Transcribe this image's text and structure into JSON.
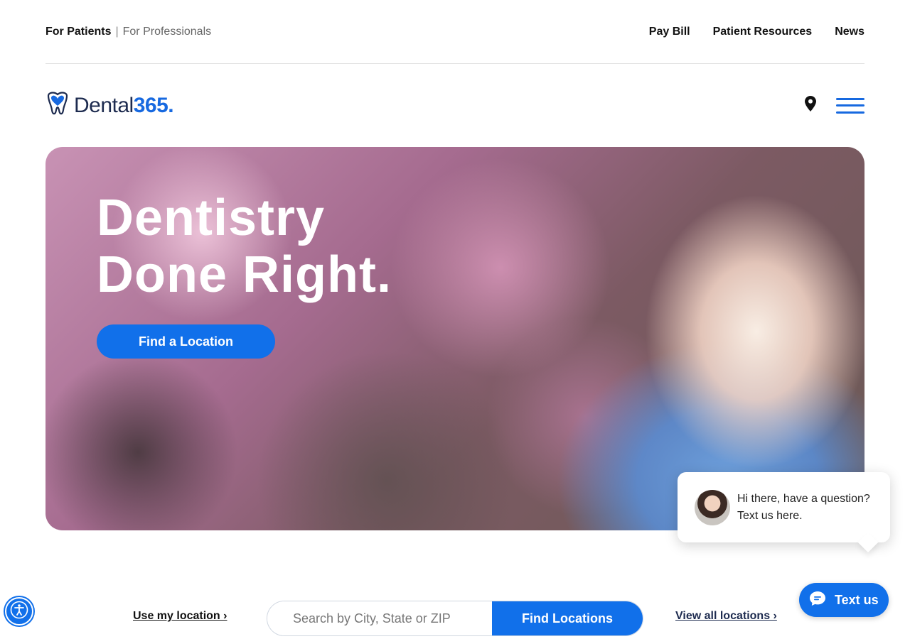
{
  "topbar": {
    "audience_active": "For Patients",
    "audience_separator": "|",
    "audience_inactive": "For Professionals",
    "links": [
      "Pay Bill",
      "Patient Resources",
      "News"
    ]
  },
  "header": {
    "logo_text": "Dental",
    "logo_number": "365",
    "logo_dot": ".",
    "location_icon": "map-pin-icon",
    "menu_icon": "hamburger-menu-icon"
  },
  "hero": {
    "heading_line1": "Dentistry",
    "heading_line2": "Done Right.",
    "cta_label": "Find a Location"
  },
  "chat": {
    "message": "Hi there, have a question? Text us here.",
    "button_label": "Text us"
  },
  "search": {
    "use_location_label": "Use my location ›",
    "placeholder": "Search by City, State or ZIP",
    "button_label": "Find Locations",
    "view_all_label": "View all locations ›"
  },
  "colors": {
    "brand_blue": "#1170ea",
    "logo_navy": "#1d2b4f"
  }
}
